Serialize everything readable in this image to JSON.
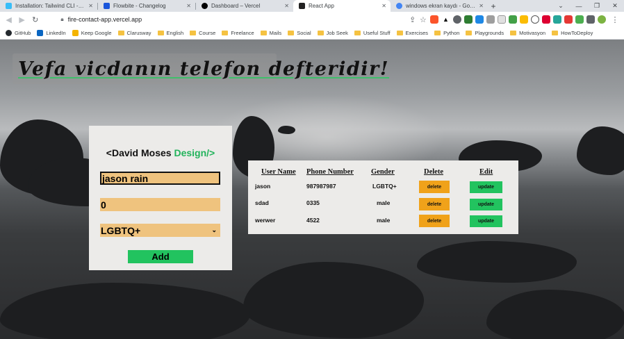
{
  "browser": {
    "tabs": [
      {
        "title": "Installation: Tailwind CLI - Tailwind CSS",
        "color": "#38bdf8",
        "active": false
      },
      {
        "title": "Flowbite - Changelog",
        "color": "#1a56db",
        "active": false
      },
      {
        "title": "Dashboard – Vercel",
        "color": "#000000",
        "active": false
      },
      {
        "title": "React App",
        "color": "#222222",
        "active": true
      },
      {
        "title": "windows ekran kaydı - Google'da Ara",
        "color": "#4285f4",
        "active": false
      }
    ],
    "new_tab_glyph": "+",
    "url": "fire-contact-app.vercel.app",
    "bookmarks": [
      {
        "label": "GitHub",
        "icon": "github-icon",
        "color": "#24292e"
      },
      {
        "label": "LinkedIn",
        "icon": "linkedin-icon",
        "color": "#0a66c2"
      },
      {
        "label": "Keep Google",
        "icon": "keep-icon",
        "color": "#f4b400"
      },
      {
        "label": "Clarusway",
        "icon": "folder-icon"
      },
      {
        "label": "English",
        "icon": "folder-icon"
      },
      {
        "label": "Course",
        "icon": "folder-icon"
      },
      {
        "label": "Freelance",
        "icon": "folder-icon"
      },
      {
        "label": "Mails",
        "icon": "folder-icon"
      },
      {
        "label": "Social",
        "icon": "folder-icon"
      },
      {
        "label": "Job Seek",
        "icon": "folder-icon"
      },
      {
        "label": "Useful Stuff",
        "icon": "folder-icon"
      },
      {
        "label": "Exercises",
        "icon": "folder-icon"
      },
      {
        "label": "Python",
        "icon": "folder-icon"
      },
      {
        "label": "Playgrounds",
        "icon": "folder-icon"
      },
      {
        "label": "Motivasyon",
        "icon": "folder-icon"
      },
      {
        "label": "HowToDeploy",
        "icon": "folder-icon"
      }
    ]
  },
  "app": {
    "motto": "Vefa vicdanın telefon defteridir!",
    "form": {
      "title_prefix": "<David Moses ",
      "title_accent": "Design/>",
      "name_value": "jason rain",
      "phone_value": "0",
      "gender_value": "LGBTQ+",
      "add_label": "Add"
    },
    "table": {
      "headers": [
        "User Name",
        "Phone Number",
        "Gender",
        "Delete",
        "Edit"
      ],
      "rows": [
        {
          "name": "jason",
          "phone": "987987987",
          "gender": "LGBTQ+"
        },
        {
          "name": "sdad",
          "phone": "0335",
          "gender": "male"
        },
        {
          "name": "werwer",
          "phone": "4522",
          "gender": "male"
        }
      ],
      "delete_label": "delete",
      "update_label": "update"
    }
  },
  "colors": {
    "accent_green": "#22c35f",
    "input_fill": "#efc37e",
    "delete_orange": "#f0a21a"
  }
}
